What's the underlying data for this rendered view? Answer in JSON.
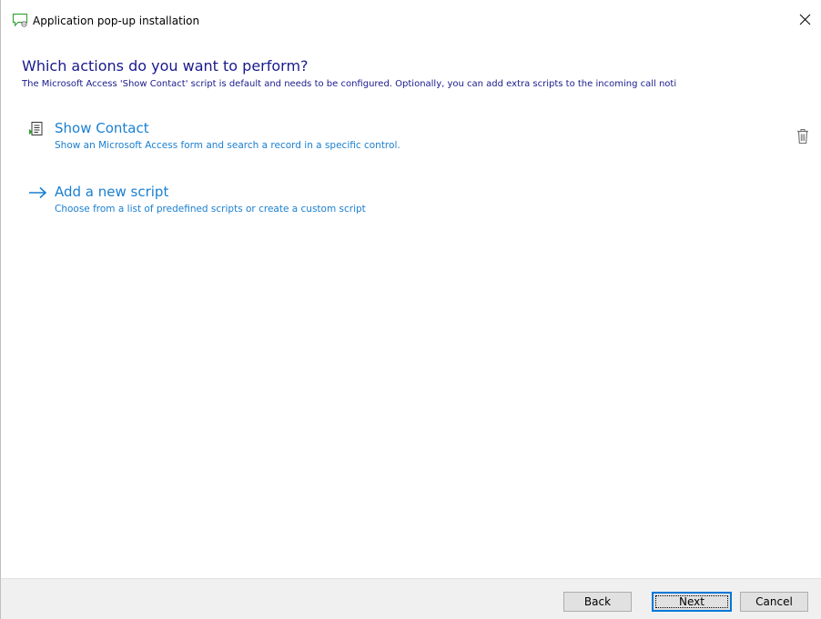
{
  "window": {
    "title": "Application pop-up installation",
    "app_icon": "chat-bubble-icon",
    "close_icon": "close-icon"
  },
  "page": {
    "heading": "Which actions do you want to perform?",
    "subheading": "The Microsoft Access 'Show Contact' script is default and needs to be configured. Optionally, you can add extra scripts to the incoming call noti"
  },
  "scripts": [
    {
      "title": "Show Contact",
      "description": "Show an Microsoft Access form and search a record in a specific control.",
      "icon": "form-document-icon",
      "delete_icon": "trash-icon"
    }
  ],
  "add_script": {
    "title": "Add a new script",
    "description": "Choose from a list of predefined scripts or create a custom script",
    "icon": "arrow-right-icon"
  },
  "footer": {
    "back_label": "Back",
    "next_label": "Next",
    "cancel_label": "Cancel"
  },
  "colors": {
    "heading": "#1a1a8c",
    "link": "#1a7fd0",
    "footer_bg": "#f0f0f0"
  }
}
